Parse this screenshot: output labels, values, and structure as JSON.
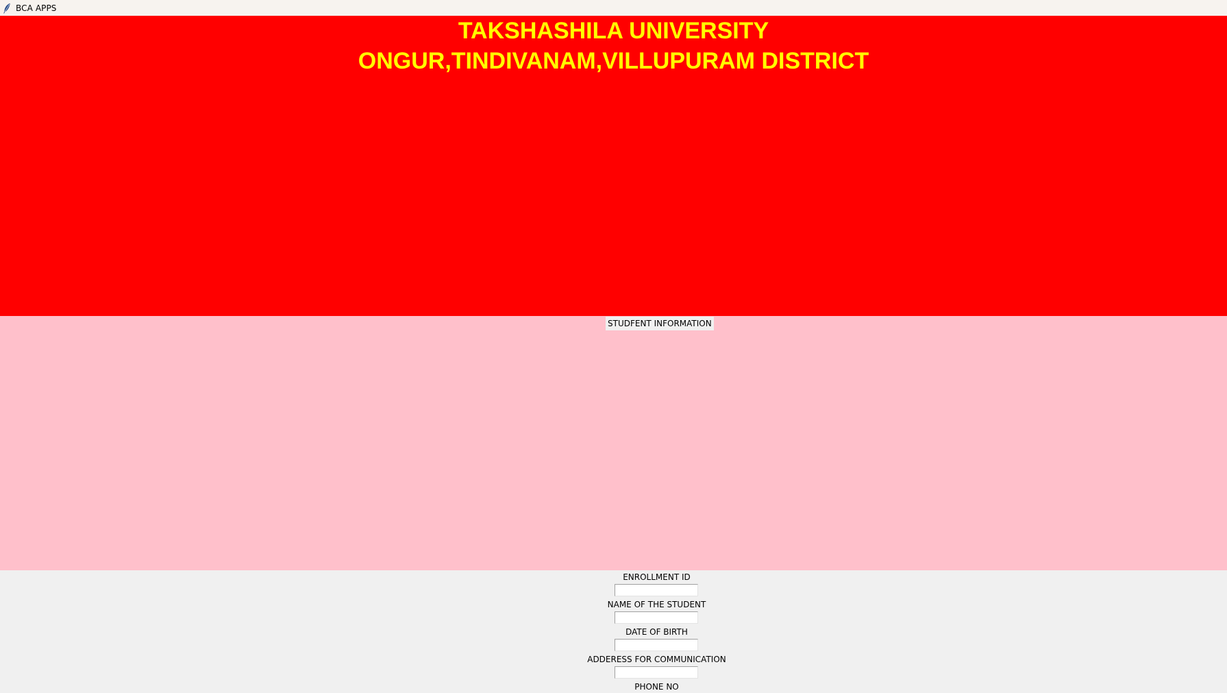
{
  "window": {
    "title": "BCA APPS",
    "icon": "feather-icon"
  },
  "header": {
    "university_name": "TAKSHASHILA UNIVERSITY",
    "address": "ONGUR,TINDIVANAM,VILLUPURAM DISTRICT"
  },
  "section": {
    "title": "STUDFENT INFORMATION"
  },
  "form": {
    "fields": [
      {
        "label": "ENROLLMENT ID",
        "value": ""
      },
      {
        "label": "NAME OF THE STUDENT",
        "value": ""
      },
      {
        "label": "DATE OF BIRTH",
        "value": ""
      },
      {
        "label": "ADDERESS FOR COMMUNICATION",
        "value": ""
      },
      {
        "label": "PHONE NO",
        "value": ""
      }
    ]
  },
  "colors": {
    "header_background": "#ff0000",
    "header_text": "#ffff00",
    "info_background": "#ffc0cb",
    "form_background": "#f0f0f0"
  }
}
